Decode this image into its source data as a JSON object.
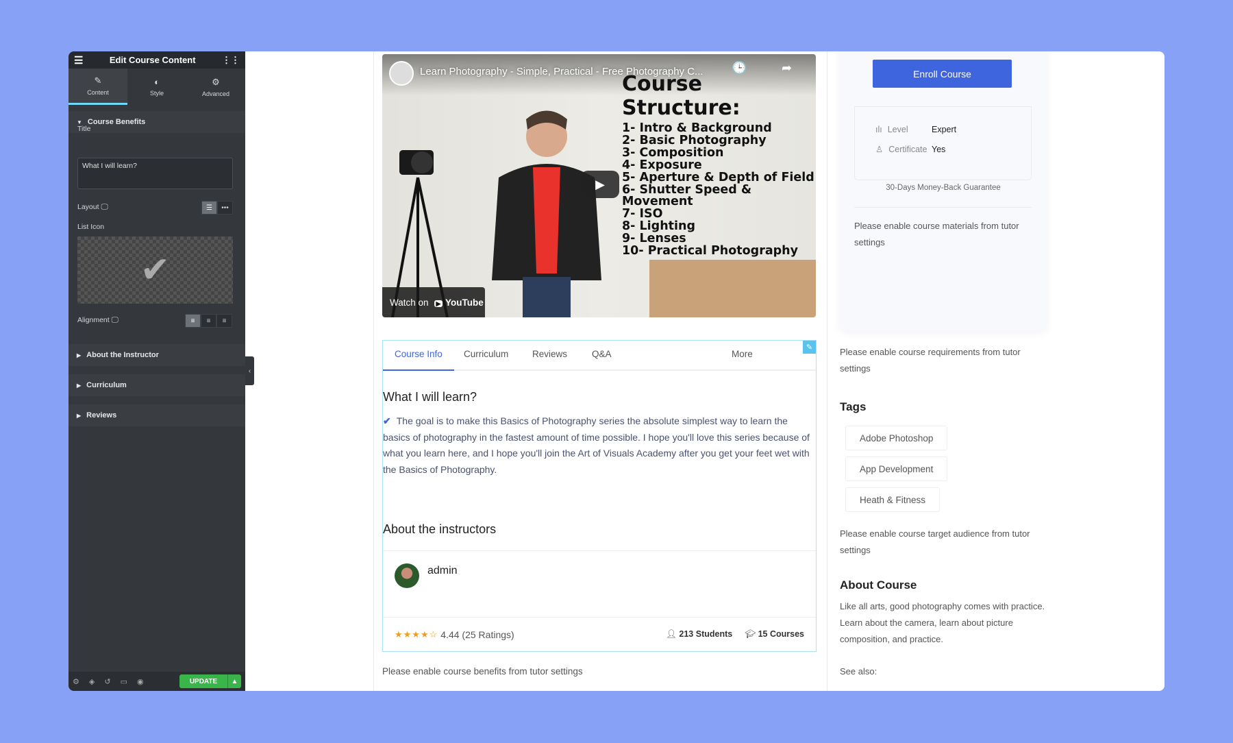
{
  "sidebar": {
    "title": "Edit Course Content",
    "tabs": [
      {
        "label": "Content",
        "icon": "pencil-icon"
      },
      {
        "label": "Style",
        "icon": "contrast-icon"
      },
      {
        "label": "Advanced",
        "icon": "gear-icon"
      }
    ],
    "section_open": "Course Benefits",
    "title_label": "Title",
    "title_value": "What I will learn?",
    "layout_label": "Layout",
    "list_icon_label": "List Icon",
    "alignment_label": "Alignment",
    "sections": [
      "About the Instructor",
      "Curriculum",
      "Reviews"
    ],
    "update_label": "UPDATE",
    "accent": "#71d7f7",
    "update_color": "#39b54a"
  },
  "video": {
    "title": "Learn Photography - Simple, Practical - Free Photography C...",
    "heading": "Course Structure:",
    "items": [
      "1- Intro & Background",
      "2- Basic Photography",
      "3- Composition",
      "4- Exposure",
      "5- Aperture & Depth of Field",
      "6- Shutter Speed & Movement",
      "7- ISO",
      "8- Lighting",
      "9- Lenses",
      "10- Practical Photography"
    ],
    "watch_on": "Watch on",
    "youtube": "YouTube"
  },
  "tabs": [
    {
      "label": "Course Info",
      "active": true
    },
    {
      "label": "Curriculum"
    },
    {
      "label": "Reviews"
    },
    {
      "label": "Q&A"
    },
    {
      "label": "More"
    }
  ],
  "benefits": {
    "title": "What I will learn?",
    "text": "The goal is to make this Basics of Photography series the absolute simplest way to learn the basics of photography in the fastest amount of time possible. I hope you'll love this series because of what you learn here, and I hope you'll join the Art of Visuals Academy after you get your feet wet with the Basics of Photography."
  },
  "instructor": {
    "heading": "About the instructors",
    "name": "admin",
    "rating": 4.44,
    "rating_text": "4.44 (25 Ratings)",
    "students": "213",
    "students_label": "Students",
    "courses": "15",
    "courses_label": "Courses"
  },
  "benefits_note": "Please enable course benefits from tutor settings",
  "side": {
    "enroll": "Enroll Course",
    "enroll_color": "#3e64de",
    "level_label": "Level",
    "level": "Expert",
    "cert_label": "Certificate",
    "cert": "Yes",
    "guarantee": "30-Days Money-Back Guarantee",
    "materials": "Please enable course materials from tutor settings",
    "requirements": "Please enable course requirements from tutor settings",
    "tags_heading": "Tags",
    "tags": [
      "Adobe Photoshop",
      "App Development",
      "Heath & Fitness"
    ],
    "audience": "Please enable course target audience from tutor settings",
    "about_heading": "About Course",
    "about": "Like all arts, good photography comes with practice. Learn about the camera, learn about picture composition, and practice.",
    "see_also": "See also:"
  }
}
